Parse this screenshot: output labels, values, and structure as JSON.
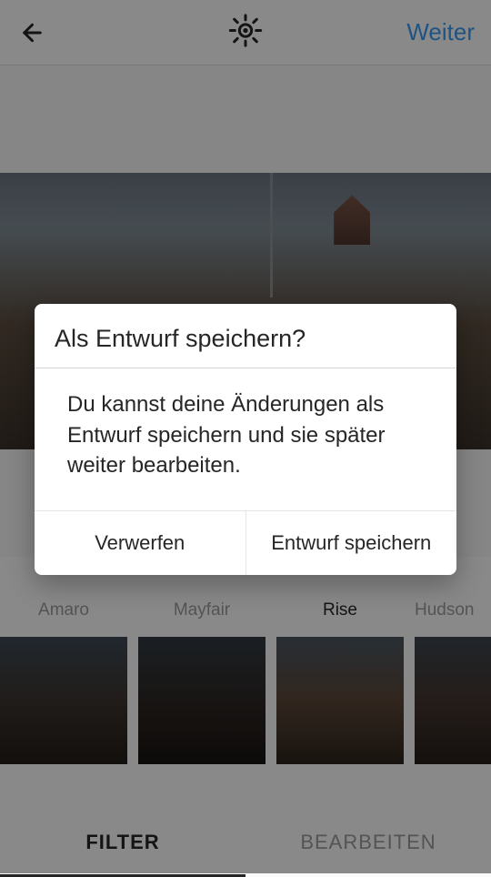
{
  "header": {
    "next_label": "Weiter"
  },
  "filters": [
    {
      "label": "Amaro",
      "active": false
    },
    {
      "label": "Mayfair",
      "active": false
    },
    {
      "label": "Rise",
      "active": true
    },
    {
      "label": "Hudson",
      "active": false
    }
  ],
  "tabs": {
    "filter_label": "FILTER",
    "edit_label": "BEARBEITEN"
  },
  "dialog": {
    "title": "Als Entwurf speichern?",
    "message": "Du kannst deine Änderungen als Entwurf speichern und sie später weiter bearbeiten.",
    "discard_label": "Verwerfen",
    "save_label": "Entwurf speichern"
  }
}
